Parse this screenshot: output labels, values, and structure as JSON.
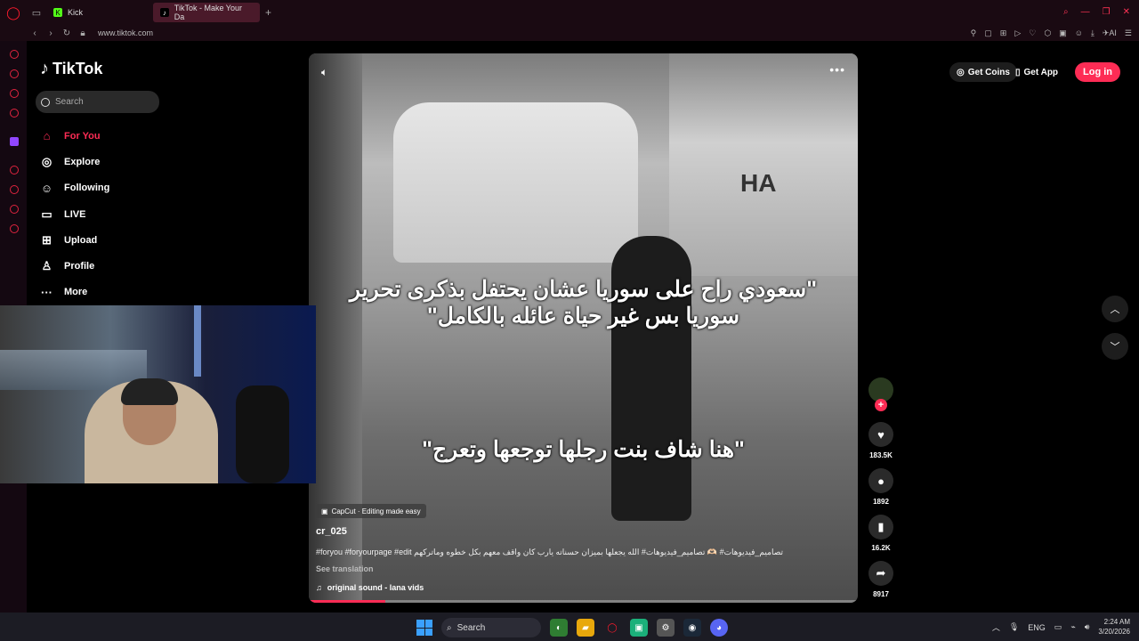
{
  "browser": {
    "tabs": [
      {
        "label": "Kick",
        "active": false
      },
      {
        "label": "TikTok - Make Your Da",
        "active": true
      }
    ],
    "url": "www.tiktok.com"
  },
  "tiktok": {
    "logo_text": "TikTok",
    "search_placeholder": "Search",
    "nav": [
      {
        "label": "For You",
        "icon": "home-icon",
        "active": true
      },
      {
        "label": "Explore",
        "icon": "compass-icon"
      },
      {
        "label": "Following",
        "icon": "person-icon"
      },
      {
        "label": "LIVE",
        "icon": "live-tv-icon"
      },
      {
        "label": "Upload",
        "icon": "plus-square-icon"
      },
      {
        "label": "Profile",
        "icon": "profile-icon"
      },
      {
        "label": "More",
        "icon": "more-dots-icon"
      }
    ],
    "header": {
      "get_coins": "Get Coins",
      "get_app": "Get App",
      "login": "Log in"
    },
    "video": {
      "caption_top": "\"سعودي راح على سوريا عشان يحتفل بذكرى تحرير سوريا بس غير حياة عائله بالكامل\"",
      "caption_bottom": "\"هنا شاف بنت رجلها توجعها وتعرج\"",
      "capcut_label": "CapCut · Editing made easy",
      "author": "cr_025",
      "description": "#foryou #foryourpage #edit تصاميم_فيديوهات# 🫶🏻 تصاميم_فيديوهات# الله يجعلها بميزان حسناته يارب كان واقف معهم بكل خطوه وماتركهم",
      "see_translation": "See translation",
      "sound": "original sound - lana vids",
      "progress": 0.14
    },
    "actions": {
      "likes": "183.5K",
      "comments": "1892",
      "saves": "16.2K",
      "shares": "8917"
    }
  },
  "taskbar": {
    "search_label": "Search",
    "lang": "ENG",
    "time": "2:24 AM",
    "date": "3/20/2026"
  },
  "colors": {
    "accent": "#fe2c55",
    "opera_red": "#ff1b2d"
  }
}
